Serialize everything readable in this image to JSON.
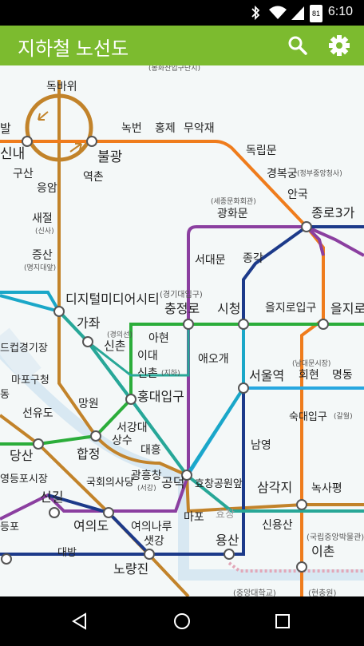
{
  "status_bar": {
    "time": "6:10",
    "battery_level": "81"
  },
  "app_bar": {
    "title": "지하철 노선도",
    "search_icon": "search-icon",
    "settings_icon": "gear-icon"
  },
  "map": {
    "stations": {
      "dokbawi": "독바위",
      "sillae": "신내",
      "bal": "발",
      "gusan": "구산",
      "eungam": "응암",
      "bulgwang": "불광",
      "yeokchon": "역촌",
      "nokbeon": "녹번",
      "hongje": "홍제",
      "muakjae": "무악재",
      "dongnimmun": "독립문",
      "gyeongbokgung": "경복궁",
      "gyeongbokgung_sub": "(정부중앙청사)",
      "anguk": "안국",
      "jongno3ga": "종로3가",
      "gwanghwamun": "광화문",
      "gwanghwamun_sub": "(세종문화회관)",
      "saejeol": "새절",
      "saejeol_sub": "(신사)",
      "jeungsan": "증산",
      "jeungsan_sub": "(명지대앞)",
      "seodaemun": "서대문",
      "jonggak": "종각",
      "dmc": "디지털미디어시티",
      "chungjeongno": "충정로",
      "chungjeongno_sub": "(경기대입구)",
      "cityhall": "시청",
      "euljiro1ga": "을지로입구",
      "euljiro3ga": "을지로",
      "gajwa": "가좌",
      "sinchon_gn": "신촌",
      "sinchon_gn_sub": "(경의선)",
      "ahyeon": "아현",
      "idae": "이대",
      "sinchon": "신촌",
      "sinchon_sub": "(지하)",
      "aeogae": "애오개",
      "seoulstation": "서울역",
      "hoehyeon": "회현",
      "hoehyeon_sub": "(남대문시장)",
      "myeongdong": "명동",
      "deungchon": "드컵경기장",
      "mapogucheong": "마포구청",
      "dong": "동",
      "mangwon": "망원",
      "hongik": "홍대입구",
      "sookmyung": "숙대입구",
      "sookmyung_sub": "(갈월)",
      "seonyudo": "선유도",
      "seogangdae": "서강대",
      "sangsu": "상수",
      "hapjeong": "합정",
      "daeheung": "대흥",
      "namyeong": "남영",
      "dangsan": "당산",
      "gwangheungchang": "광흥창",
      "gwangheungchang_sub": "(서강)",
      "gongdeok": "공덕",
      "hyochang": "효창공원앞",
      "samgakji": "삼각지",
      "noksapyeong": "녹사평",
      "yeongdeungpo_market": "영등포시장",
      "national_assembly": "국회의사당",
      "singil": "신길",
      "yeouido": "여의도",
      "yeouinaru": "여의나루",
      "mapo": "마포",
      "hyochang_gn": "효창",
      "sinyongsan": "신용산",
      "ichon": "이촌",
      "ichon_sub": "(국립중앙박물관)",
      "deungpo": "등포",
      "daebang": "대방",
      "saetgang": "샛강",
      "yongsan": "용산",
      "noryangjin": "노량진",
      "top_partial": "(봉화산입구단지)",
      "bottom_partial_a": "(중앙대학교)",
      "bottom_partial_b": "(현충원)"
    }
  },
  "nav_bar": {
    "back": "back-icon",
    "home": "home-icon",
    "recents": "recents-icon"
  },
  "colors": {
    "app_bar": "#7cbb2f",
    "line1": "#1c3a8a",
    "line2": "#2bad3a",
    "line3": "#ef7c1c",
    "line4": "#27a7e0",
    "line5": "#8b3fa0",
    "line6": "#c2832a",
    "gyeongui": "#28a797",
    "airport": "#1aa7c8"
  }
}
